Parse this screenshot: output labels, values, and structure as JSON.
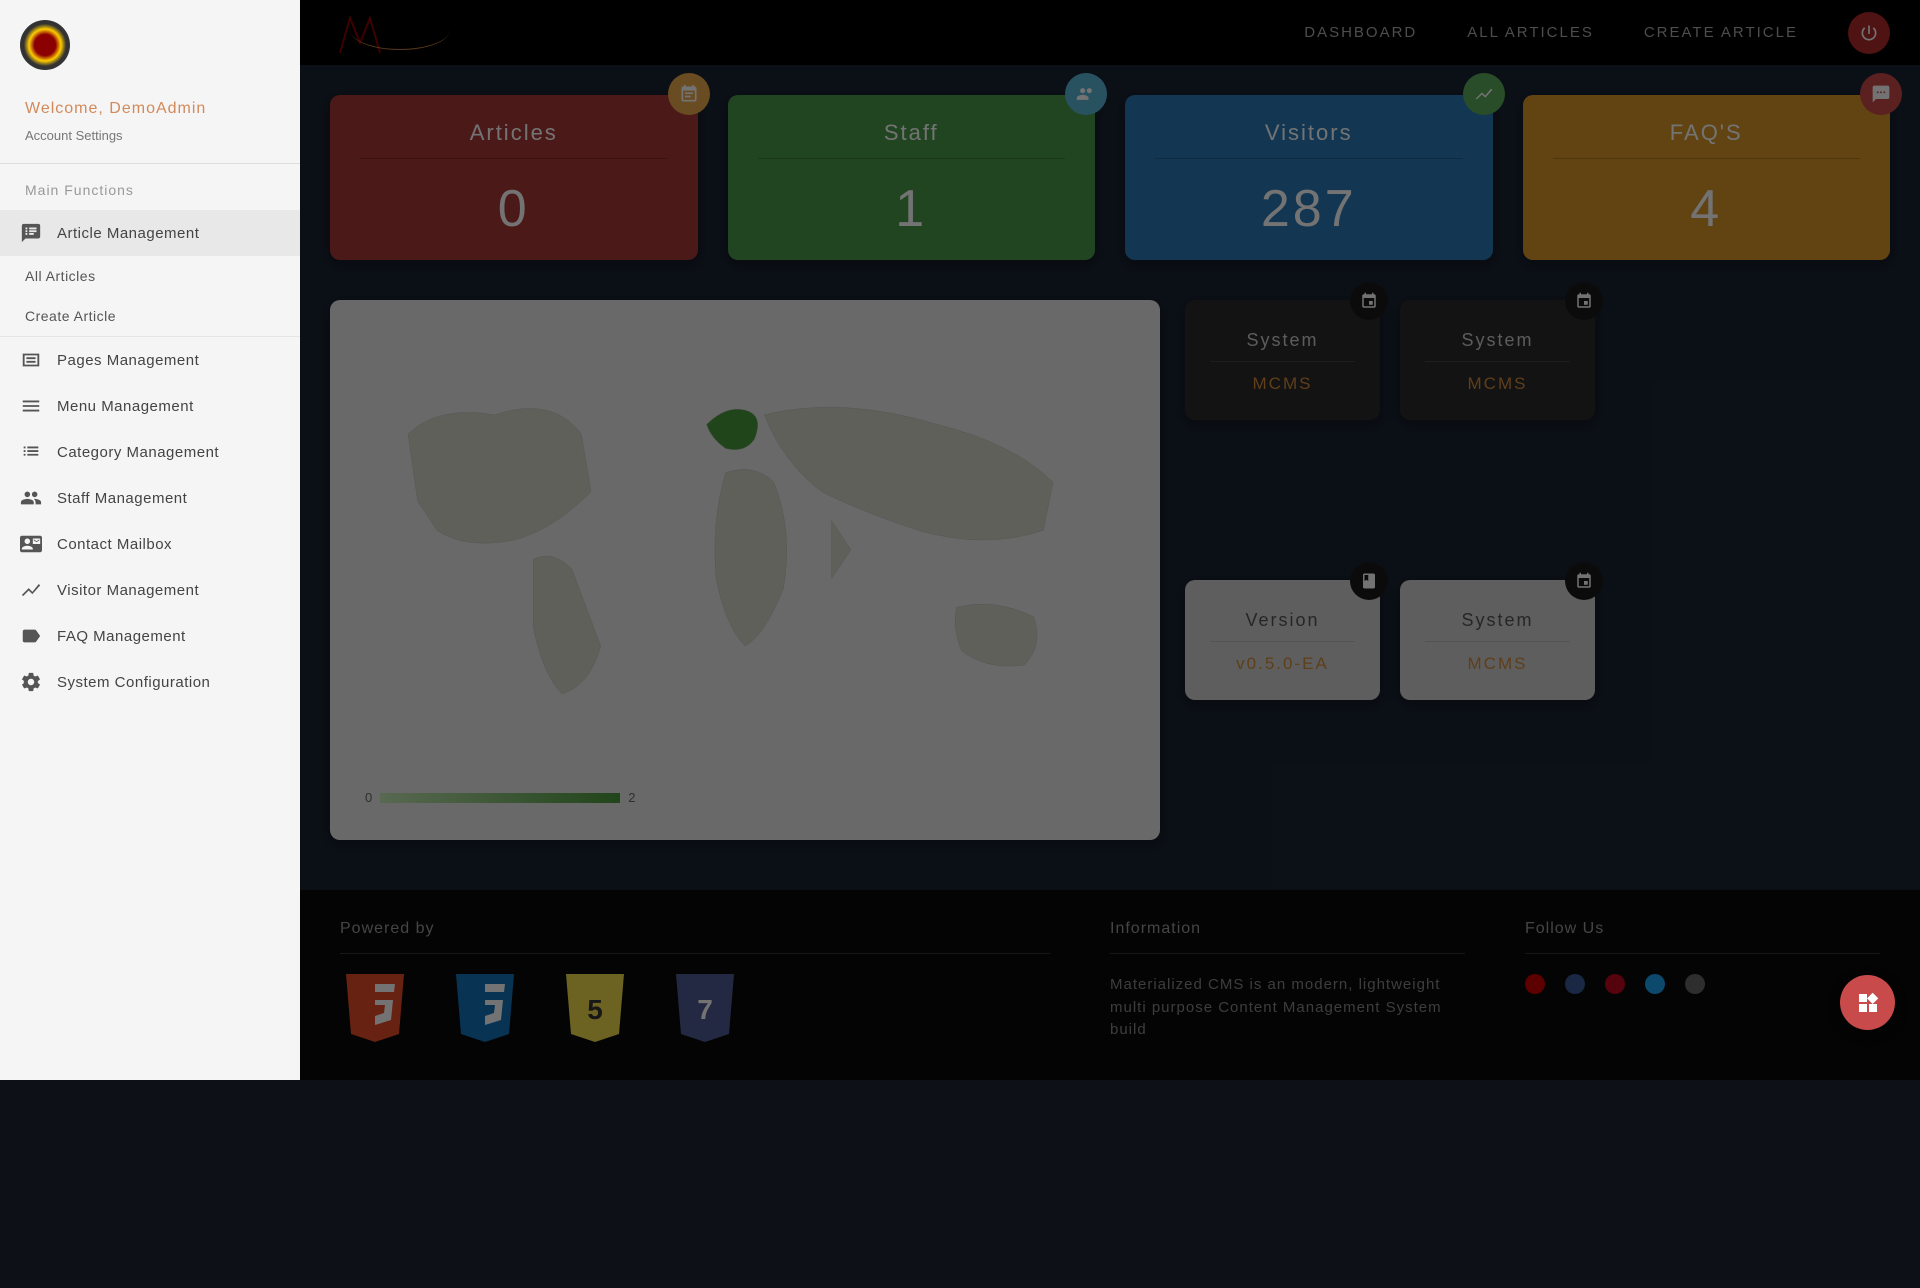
{
  "sidebar": {
    "welcome": "Welcome, DemoAdmin",
    "account_settings": "Account Settings",
    "section_label": "Main Functions",
    "items": [
      {
        "label": "Article Management",
        "icon": "speaker-notes-icon",
        "active": true
      },
      {
        "label": "Pages Management",
        "icon": "pages-icon"
      },
      {
        "label": "Menu Management",
        "icon": "menu-icon"
      },
      {
        "label": "Category Management",
        "icon": "list-icon"
      },
      {
        "label": "Staff Management",
        "icon": "group-icon"
      },
      {
        "label": "Contact Mailbox",
        "icon": "contact-mail-icon"
      },
      {
        "label": "Visitor Management",
        "icon": "trending-icon"
      },
      {
        "label": "FAQ Management",
        "icon": "label-icon"
      },
      {
        "label": "System Configuration",
        "icon": "settings-icon"
      }
    ],
    "sub_items": [
      {
        "label": "All Articles"
      },
      {
        "label": "Create Article"
      }
    ]
  },
  "topnav": {
    "brand": "CMS",
    "links": [
      {
        "label": "DASHBOARD"
      },
      {
        "label": "ALL ARTICLES"
      },
      {
        "label": "CREATE ARTICLE"
      }
    ]
  },
  "stat_cards": [
    {
      "title": "Articles",
      "value": "0",
      "color": "red",
      "icon": "event-note-icon"
    },
    {
      "title": "Staff",
      "value": "1",
      "color": "green",
      "icon": "group-icon"
    },
    {
      "title": "Visitors",
      "value": "287",
      "color": "blue",
      "icon": "trending-icon"
    },
    {
      "title": "FAQ'S",
      "value": "4",
      "color": "orange",
      "icon": "comment-icon"
    }
  ],
  "map": {
    "legend_min": "0",
    "legend_max": "2"
  },
  "info_cards": [
    {
      "title": "System",
      "value": "MCMS",
      "theme": "dark",
      "icon": "event-icon"
    },
    {
      "title": "System",
      "value": "MCMS",
      "theme": "dark",
      "icon": "event-icon"
    },
    {
      "title": "Version",
      "value": "v0.5.0-EA",
      "theme": "light",
      "icon": "class-icon"
    },
    {
      "title": "System",
      "value": "MCMS",
      "theme": "light",
      "icon": "event-icon"
    }
  ],
  "footer": {
    "powered_by": "Powered by",
    "information": "Information",
    "info_text": "Materialized CMS is an modern, lightweight multi purpose Content Management System build",
    "follow_us": "Follow Us",
    "tech": [
      "HTML5",
      "CSS3",
      "JS",
      "PHP7"
    ]
  },
  "colors": {
    "accent": "#d28a5a",
    "card_value": "#d28a3a"
  }
}
